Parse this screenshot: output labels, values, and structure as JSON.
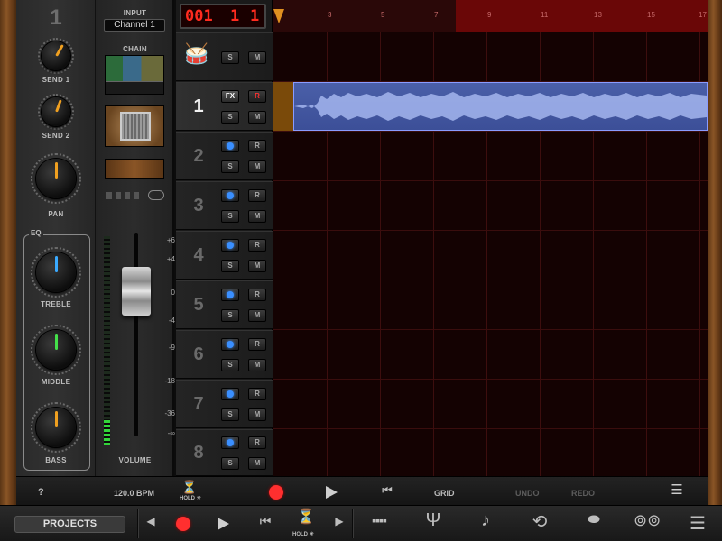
{
  "mixer": {
    "channel_number": "1",
    "send1_label": "SEND 1",
    "send2_label": "SEND 2",
    "pan_label": "PAN",
    "eq_label": "EQ",
    "treble_label": "TREBLE",
    "middle_label": "MIDDLE",
    "bass_label": "BASS",
    "accent_colors": {
      "send": "#f0a020",
      "treble": "#3aaaff",
      "middle": "#44e04a",
      "bass": "#f0a020"
    }
  },
  "channel_panel": {
    "input_label": "INPUT",
    "input_value": "Channel 1",
    "chain_label": "CHAIN",
    "volume_label": "VOLUME",
    "volume_scale": [
      "+6",
      "+4",
      "0",
      "-4",
      "-9",
      "-18",
      "-36",
      "-∞"
    ]
  },
  "transport_display": {
    "bar": "001",
    "beat": "1",
    "tick": "1"
  },
  "tracks": [
    {
      "number": "",
      "type": "drums",
      "solo": "S",
      "mute": "M"
    },
    {
      "number": "1",
      "type": "fx",
      "fx": "FX",
      "rec": "R",
      "solo": "S",
      "mute": "M"
    },
    {
      "number": "2",
      "rec": "R",
      "solo": "S",
      "mute": "M"
    },
    {
      "number": "3",
      "rec": "R",
      "solo": "S",
      "mute": "M"
    },
    {
      "number": "4",
      "rec": "R",
      "solo": "S",
      "mute": "M"
    },
    {
      "number": "5",
      "rec": "R",
      "solo": "S",
      "mute": "M"
    },
    {
      "number": "6",
      "rec": "R",
      "solo": "S",
      "mute": "M"
    },
    {
      "number": "7",
      "rec": "R",
      "solo": "S",
      "mute": "M"
    },
    {
      "number": "8",
      "rec": "R",
      "solo": "S",
      "mute": "M"
    }
  ],
  "ruler": {
    "marks": [
      "3",
      "5",
      "7",
      "9",
      "11",
      "13",
      "15",
      "17"
    ]
  },
  "toolbar": {
    "help": "?",
    "tempo": "120.0 BPM",
    "hold": "HOLD ☀",
    "grid": "GRID",
    "undo": "UNDO",
    "redo": "REDO"
  },
  "bottom_bar": {
    "projects": "PROJECTS",
    "hold": "HOLD ☀",
    "menu_icon": "hamburger-icon"
  }
}
